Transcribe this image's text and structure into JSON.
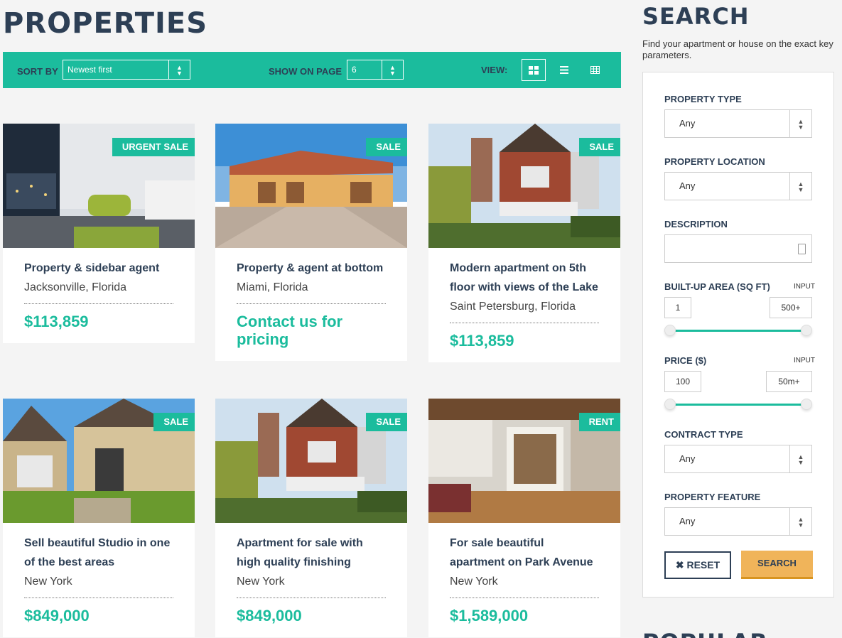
{
  "page_title": "PROPERTIES",
  "toolbar": {
    "sort_label": "SORT BY",
    "sort_value": "Newest first",
    "show_label": "SHOW ON PAGE",
    "show_value": "6",
    "view_label": "VIEW:",
    "accent_color": "#1bbc9d"
  },
  "properties": [
    {
      "badge": "URGENT SALE",
      "title": "Property & sidebar agent",
      "location": "Jacksonville, Florida",
      "price": "$113,859"
    },
    {
      "badge": "SALE",
      "title": "Property & agent at bottom",
      "location": "Miami, Florida",
      "price": "Contact us for pricing"
    },
    {
      "badge": "SALE",
      "title": "Modern apartment on 5th floor with views of the Lake",
      "location": "Saint Petersburg, Florida",
      "price": "$113,859"
    },
    {
      "badge": "SALE",
      "title": "Sell beautiful Studio in one of the best areas",
      "location": "New York",
      "price": "$849,000"
    },
    {
      "badge": "SALE",
      "title": "Apartment for sale with high quality finishing",
      "location": "New York",
      "price": "$849,000"
    },
    {
      "badge": "RENT",
      "title": "For sale beautiful apartment on Park Avenue",
      "location": "New York",
      "price": "$1,589,000"
    }
  ],
  "sidebar": {
    "title": "SEARCH",
    "description": "Find your apartment or house on the exact key parameters.",
    "property_type_label": "PROPERTY TYPE",
    "property_type_value": "Any",
    "property_location_label": "PROPERTY LOCATION",
    "property_location_value": "Any",
    "description_label": "DESCRIPTION",
    "area_label": "BUILT-UP AREA (SQ FT)",
    "area_input_label": "INPUT",
    "area_min": "1",
    "area_max": "500+",
    "price_label": "PRICE ($)",
    "price_input_label": "INPUT",
    "price_min": "100",
    "price_max": "50m+",
    "contract_label": "CONTRACT TYPE",
    "contract_value": "Any",
    "feature_label": "PROPERTY FEATURE",
    "feature_value": "Any",
    "reset_label": "✖ RESET",
    "search_label": "SEARCH",
    "popular_title": "POPULAR"
  }
}
